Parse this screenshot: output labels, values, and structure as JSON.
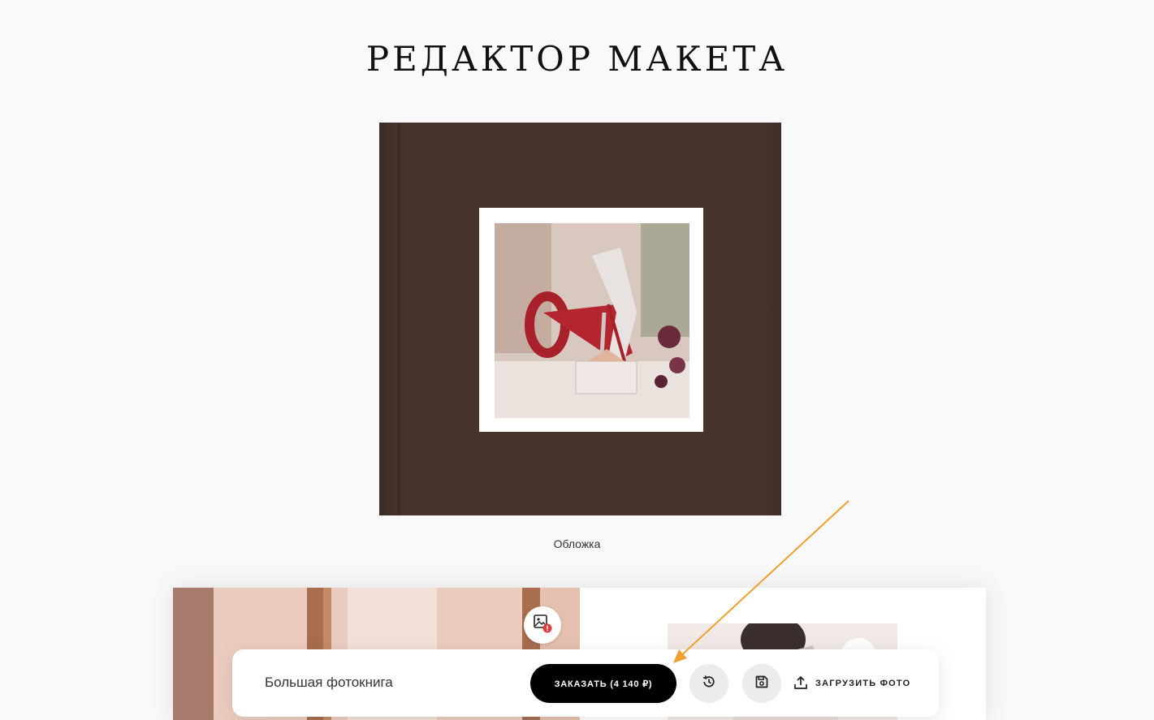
{
  "header": {
    "title": "РЕДАКТОР МАКЕТА"
  },
  "cover": {
    "caption": "Обложка"
  },
  "toolbar": {
    "product_name": "Большая фотокнига",
    "order_label": "ЗАКАЗАТЬ (4 140 ₽)",
    "upload_label": "ЗАГРУЗИТЬ ФОТО"
  },
  "icons": {
    "warning": "image-warning-icon",
    "history": "history-icon",
    "save": "save-icon",
    "upload": "upload-icon"
  },
  "colors": {
    "cover": "#47352c",
    "order_button": "#000000",
    "annotation_arrow": "#f0a030",
    "warning_badge": "#e53935"
  }
}
